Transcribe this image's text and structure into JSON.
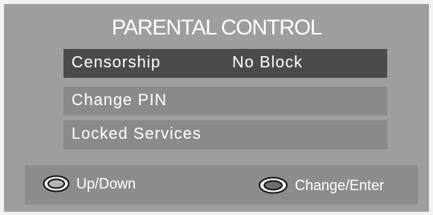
{
  "menu": {
    "title": "PARENTAL CONTROL",
    "items": [
      {
        "label": "Censorship",
        "value": "No Block",
        "selected": true
      },
      {
        "label": "Change PIN"
      },
      {
        "label": "Locked Services"
      }
    ]
  },
  "footer": {
    "updown": {
      "label": "Up/Down",
      "icon": "up-down-button-icon"
    },
    "enter": {
      "label": "Change/Enter",
      "icon": "enter-button-icon"
    }
  },
  "colors": {
    "panel": "#9e9e9e",
    "row": "#8a8a8a",
    "row_selected": "#4b4b4b",
    "text": "#ffffff"
  }
}
